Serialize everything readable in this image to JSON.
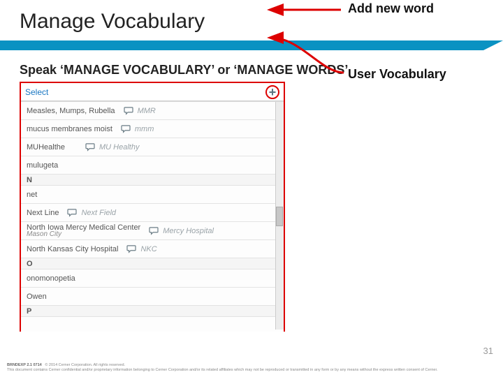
{
  "title": "Manage Vocabulary",
  "instruction": "Speak ‘MANAGE VOCABULARY’ or ‘MANAGE WORDS’",
  "callouts": {
    "add": "Add new word",
    "userVocab": "User Vocabulary"
  },
  "screenshot": {
    "select_label": "Select",
    "plus_glyph": "+",
    "rows": [
      {
        "type": "item",
        "main": "Measles, Mumps, Rubella",
        "spoken": "MMR"
      },
      {
        "type": "item",
        "main": "mucus membranes moist",
        "spoken": "mmm"
      },
      {
        "type": "item",
        "main": "MUHealthe",
        "spoken": "MU Healthy",
        "cls": "mh"
      },
      {
        "type": "item",
        "main": "mulugeta"
      },
      {
        "type": "letter",
        "main": "N"
      },
      {
        "type": "item",
        "main": "net"
      },
      {
        "type": "item",
        "main": "Next Line",
        "spoken": "Next Field"
      },
      {
        "type": "item",
        "main": "North Iowa Mercy Medical Center",
        "sub": "Mason City",
        "spoken": "Mercy Hospital"
      },
      {
        "type": "item",
        "main": "North Kansas City Hospital",
        "spoken": "NKC"
      },
      {
        "type": "letter",
        "main": "O"
      },
      {
        "type": "item",
        "main": "onomonopetia"
      },
      {
        "type": "item",
        "main": "Owen"
      },
      {
        "type": "letter",
        "main": "P"
      }
    ]
  },
  "page_number": "31",
  "footer": {
    "l1a": "BRNDEXP 2.1 0714",
    "l1b": "© 2014 Cerner Corporation. All rights reserved.",
    "l2": "This document contains Cerner confidential and/or proprietary information belonging to Cerner Corporation and/or its related affiliates which may not be reproduced or transmitted in any form or by any means without the express written consent of Cerner."
  }
}
